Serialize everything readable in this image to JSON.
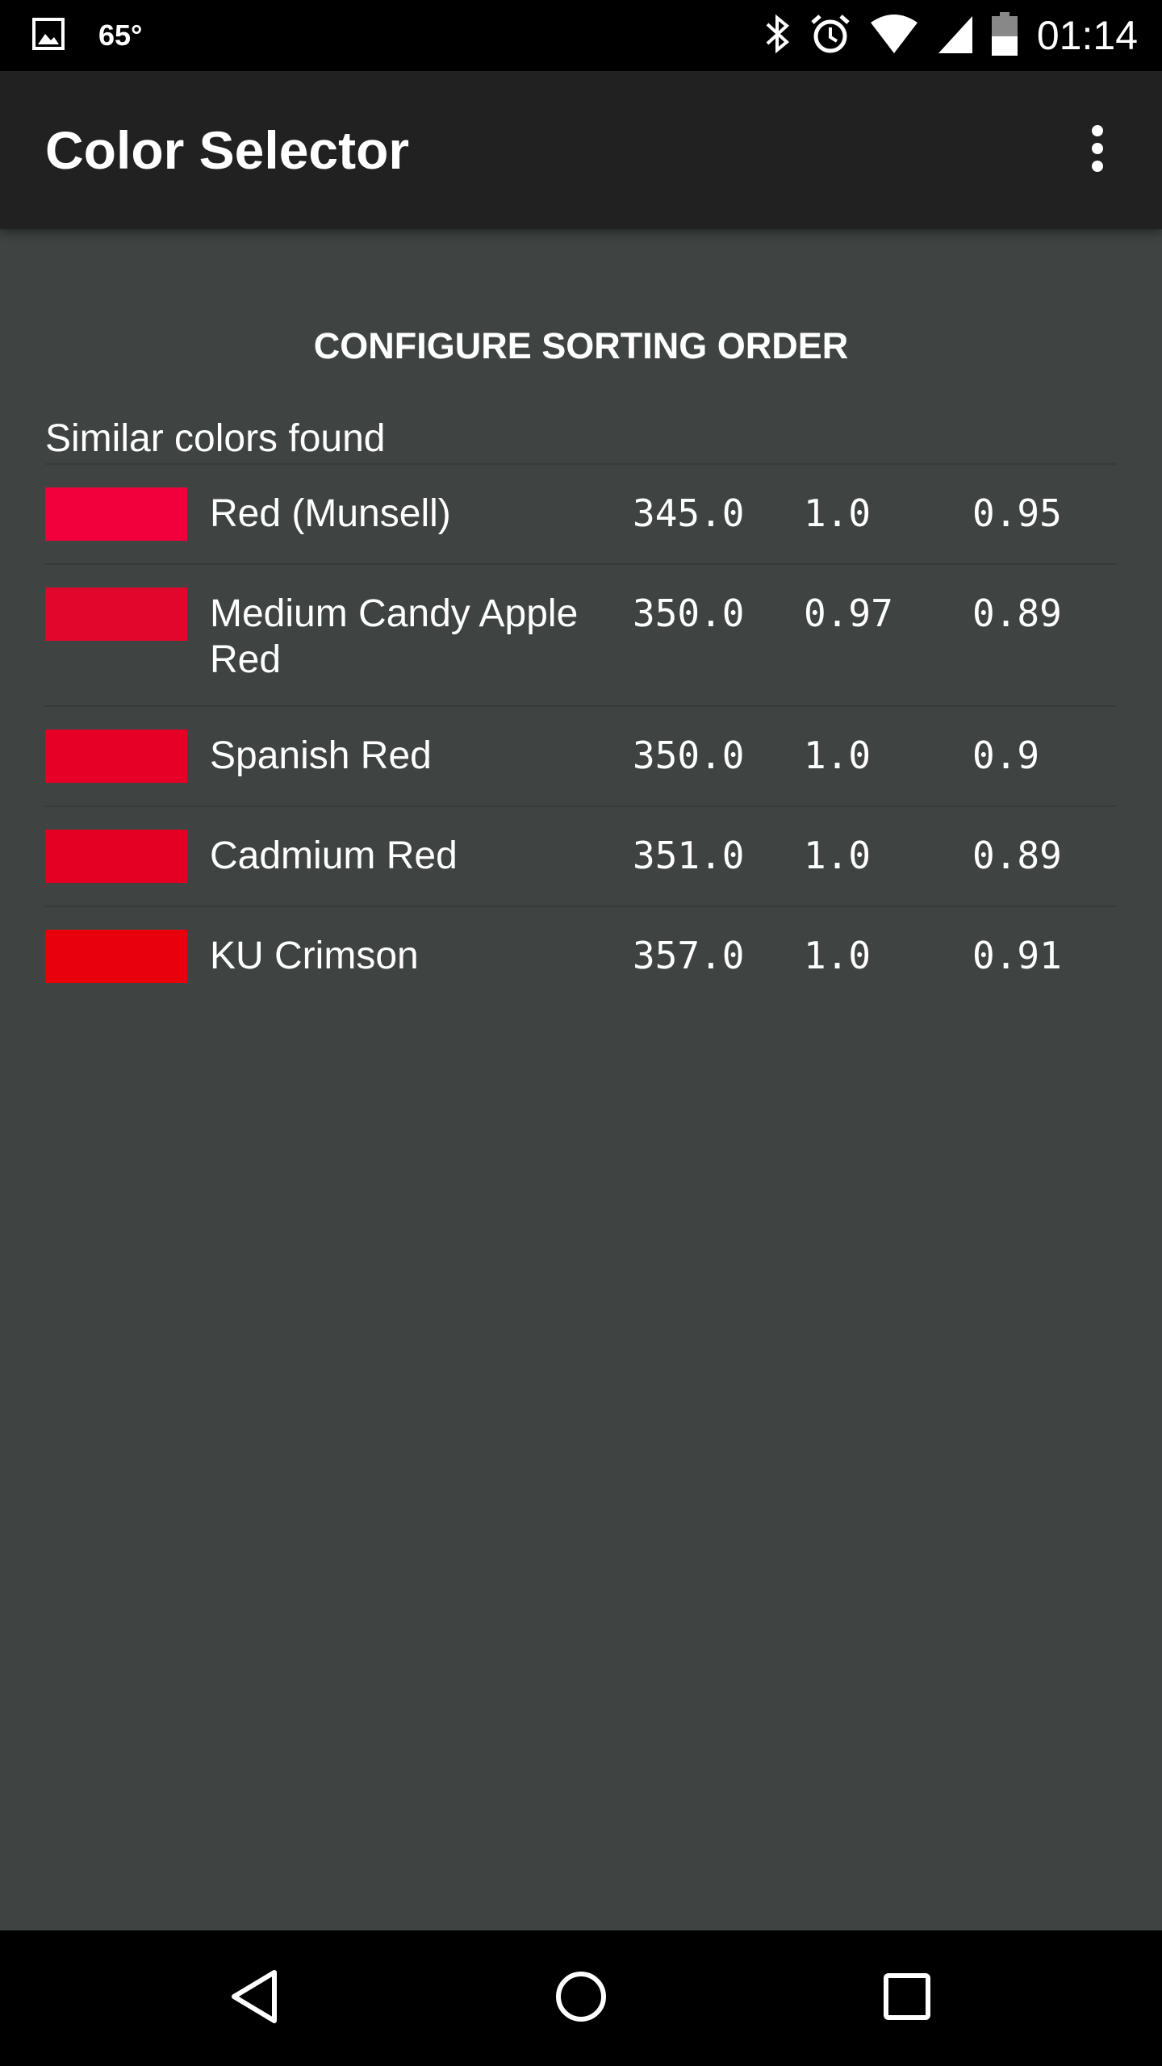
{
  "status_bar": {
    "temperature": "65°",
    "time": "01:14",
    "icons": [
      "image-icon",
      "bluetooth-icon",
      "alarm-icon",
      "wifi-icon",
      "signal-icon",
      "battery-icon"
    ]
  },
  "app_bar": {
    "title": "Color Selector",
    "menu_icon": "overflow-menu-icon"
  },
  "main": {
    "configure_button": "CONFIGURE SORTING ORDER",
    "section_label": "Similar colors found",
    "colors": [
      {
        "name": "Red (Munsell)",
        "h": "345.0",
        "s": "1.0",
        "v": "0.95",
        "swatch": "#f2003c"
      },
      {
        "name": "Medium Candy Apple Red",
        "h": "350.0",
        "s": "0.97",
        "v": "0.89",
        "swatch": "#e2062c"
      },
      {
        "name": "Spanish Red",
        "h": "350.0",
        "s": "1.0",
        "v": "0.9",
        "swatch": "#e60026"
      },
      {
        "name": "Cadmium Red",
        "h": "351.0",
        "s": "1.0",
        "v": "0.89",
        "swatch": "#e30022"
      },
      {
        "name": "KU Crimson",
        "h": "357.0",
        "s": "1.0",
        "v": "0.91",
        "swatch": "#e8000d"
      }
    ]
  },
  "nav_bar": {
    "icons": [
      "back-icon",
      "home-icon",
      "recents-icon"
    ]
  }
}
